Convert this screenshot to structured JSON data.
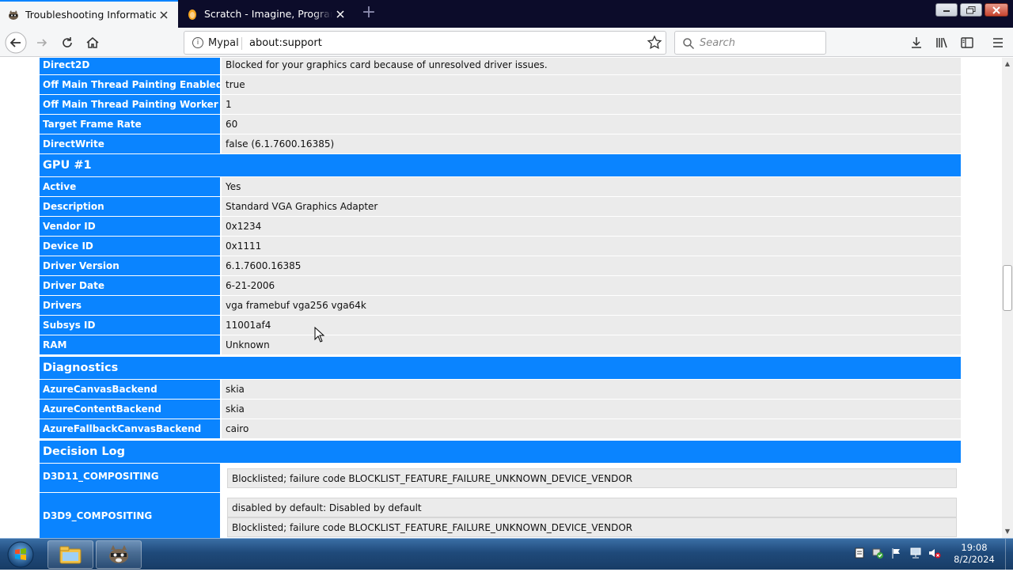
{
  "browser": {
    "tabs": [
      {
        "title": "Troubleshooting Information",
        "active": true,
        "favicon": "raccoon-icon"
      },
      {
        "title": "Scratch - Imagine, Program, Share",
        "active": false,
        "favicon": "scratch-cat-icon"
      }
    ],
    "identity_label": "Mypal",
    "url": "about:support",
    "search_placeholder": "Search"
  },
  "rows_top": [
    {
      "key": "Direct2D",
      "value": "Blocked for your graphics card because of unresolved driver issues."
    },
    {
      "key": "Off Main Thread Painting Enabled",
      "value": "true"
    },
    {
      "key": "Off Main Thread Painting Worker Count",
      "value": "1"
    },
    {
      "key": "Target Frame Rate",
      "value": "60"
    },
    {
      "key": "DirectWrite",
      "value": "false (6.1.7600.16385)"
    }
  ],
  "gpu1": {
    "title": "GPU #1",
    "rows": [
      {
        "key": "Active",
        "value": "Yes"
      },
      {
        "key": "Description",
        "value": "Standard VGA Graphics Adapter"
      },
      {
        "key": "Vendor ID",
        "value": "0x1234"
      },
      {
        "key": "Device ID",
        "value": "0x1111"
      },
      {
        "key": "Driver Version",
        "value": "6.1.7600.16385"
      },
      {
        "key": "Driver Date",
        "value": "6-21-2006"
      },
      {
        "key": "Drivers",
        "value": "vga framebuf vga256 vga64k"
      },
      {
        "key": "Subsys ID",
        "value": "11001af4"
      },
      {
        "key": "RAM",
        "value": "Unknown"
      }
    ]
  },
  "diagnostics": {
    "title": "Diagnostics",
    "rows": [
      {
        "key": "AzureCanvasBackend",
        "value": "skia"
      },
      {
        "key": "AzureContentBackend",
        "value": "skia"
      },
      {
        "key": "AzureFallbackCanvasBackend",
        "value": "cairo"
      }
    ]
  },
  "decision_log": {
    "title": "Decision Log",
    "rows": [
      {
        "key": "D3D11_COMPOSITING",
        "values": [
          "Blocklisted; failure code BLOCKLIST_FEATURE_FAILURE_UNKNOWN_DEVICE_VENDOR"
        ]
      },
      {
        "key": "D3D9_COMPOSITING",
        "values": [
          "disabled by default: Disabled by default",
          "Blocklisted; failure code BLOCKLIST_FEATURE_FAILURE_UNKNOWN_DEVICE_VENDOR"
        ]
      }
    ]
  },
  "taskbar": {
    "time": "19:08",
    "date": "8/2/2024",
    "items": [
      "file-explorer-icon",
      "mypal-browser-icon"
    ]
  },
  "colors": {
    "accent": "#0a84ff",
    "value_bg": "#ebebeb",
    "tabstrip_bg": "#0c0c2a"
  }
}
